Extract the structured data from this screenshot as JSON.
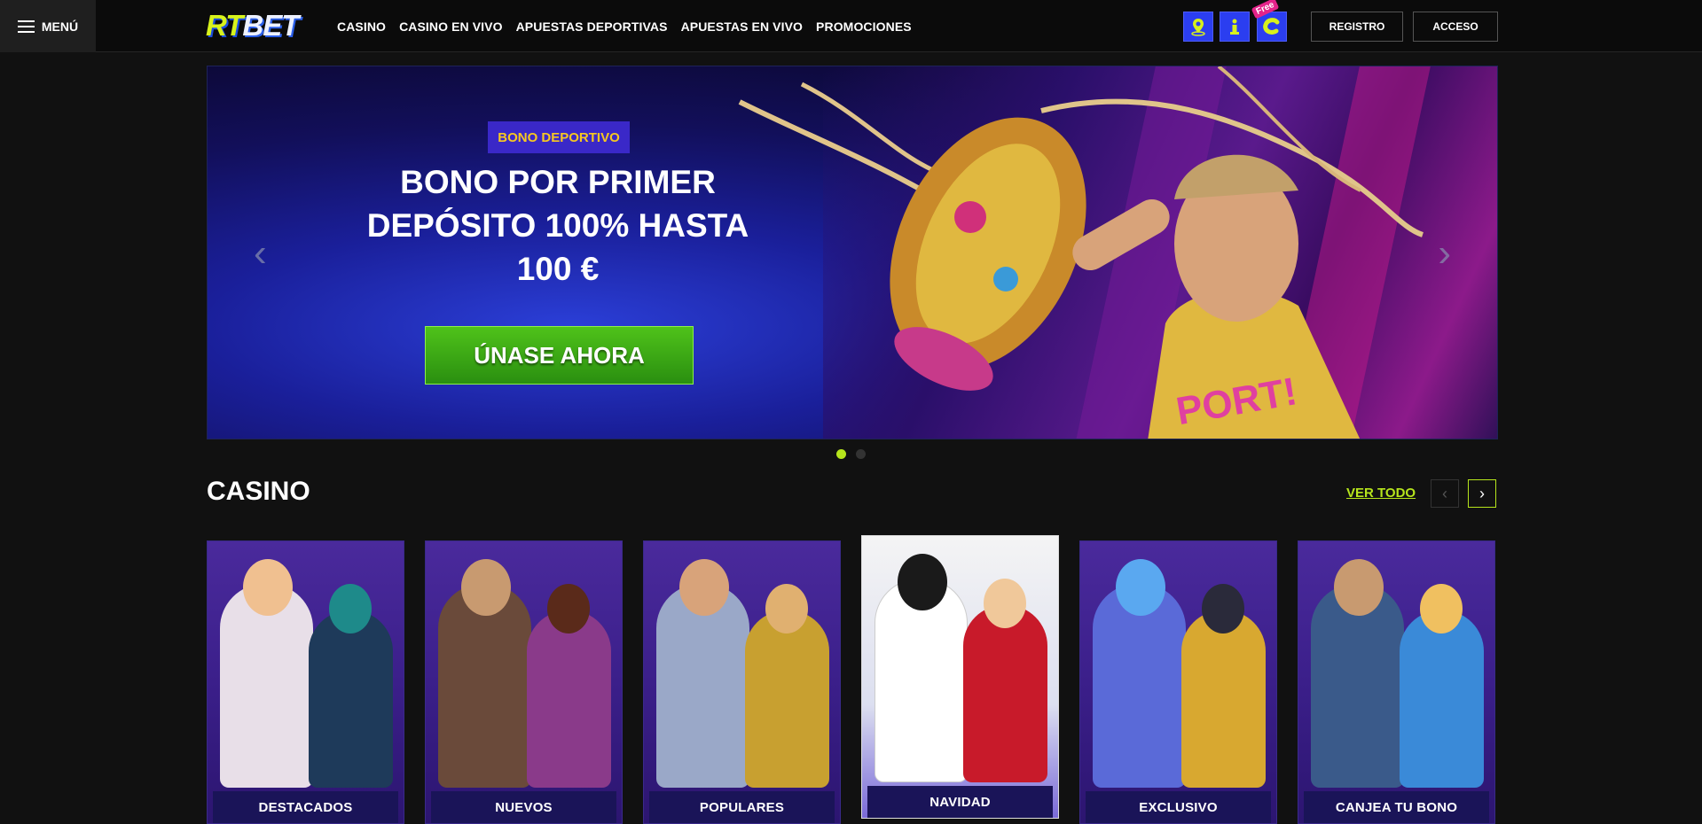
{
  "header": {
    "menu_label": "MENÚ",
    "logo_rt": "RT",
    "logo_bet": "BET",
    "nav": [
      "CASINO",
      "CASINO EN VIVO",
      "APUESTAS DEPORTIVAS",
      "APUESTAS EN VIVO",
      "PROMOCIONES"
    ],
    "free_badge": "Free",
    "register_label": "REGISTRO",
    "login_label": "ACCESO"
  },
  "banner": {
    "badge": "BONO DEPORTIVO",
    "title": "BONO POR PRIMER DEPÓSITO 100% HASTA 100 €",
    "cta": "ÚNASE AHORA",
    "prev_arrow": "‹",
    "next_arrow": "›",
    "slides_total": 2,
    "active_slide": 1
  },
  "casino": {
    "title": "CASINO",
    "see_all": "VER TODO",
    "prev": "‹",
    "next": "›",
    "cards": [
      "DESTACADOS",
      "NUEVOS",
      "POPULARES",
      "NAVIDAD",
      "EXCLUSIVO",
      "CANJEA TU BONO"
    ]
  },
  "colors": {
    "accent": "#b6e51c",
    "bg": "#111111",
    "icon_blue": "#2b3ef0",
    "cta_green": "#3aa817"
  },
  "icons": [
    "menu-icon",
    "location-icon",
    "info-icon",
    "free-coin-icon"
  ]
}
